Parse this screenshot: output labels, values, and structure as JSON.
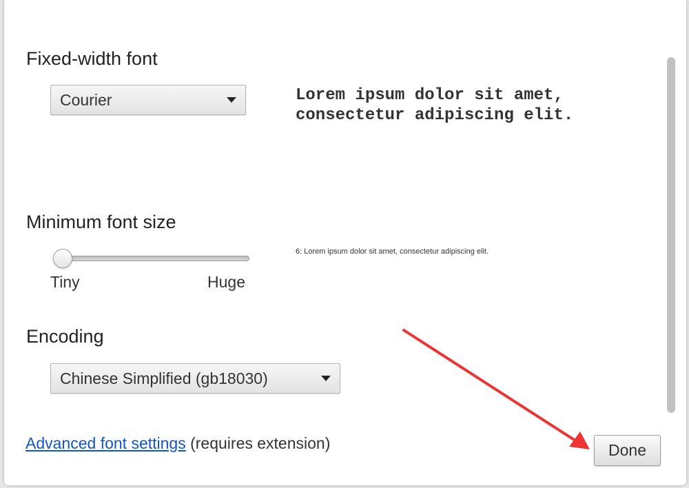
{
  "fixed_width": {
    "title": "Fixed-width font",
    "select_value": "Courier",
    "sample_line1": "Lorem ipsum dolor sit amet,",
    "sample_line2": "consectetur adipiscing elit."
  },
  "minimum_size": {
    "title": "Minimum font size",
    "slider_value_fraction": 0.0,
    "min_label": "Tiny",
    "max_label": "Huge",
    "sample_text": "6: Lorem ipsum dolor sit amet, consectetur adipiscing elit."
  },
  "encoding": {
    "title": "Encoding",
    "select_value": "Chinese Simplified (gb18030)"
  },
  "advanced": {
    "link_text": "Advanced font settings",
    "suffix": "(requires extension)"
  },
  "footer": {
    "done_label": "Done"
  },
  "colors": {
    "link": "#1155cc",
    "annotation_arrow": "#ee3333"
  },
  "icons": {
    "dropdown": "chevron-down-icon"
  }
}
